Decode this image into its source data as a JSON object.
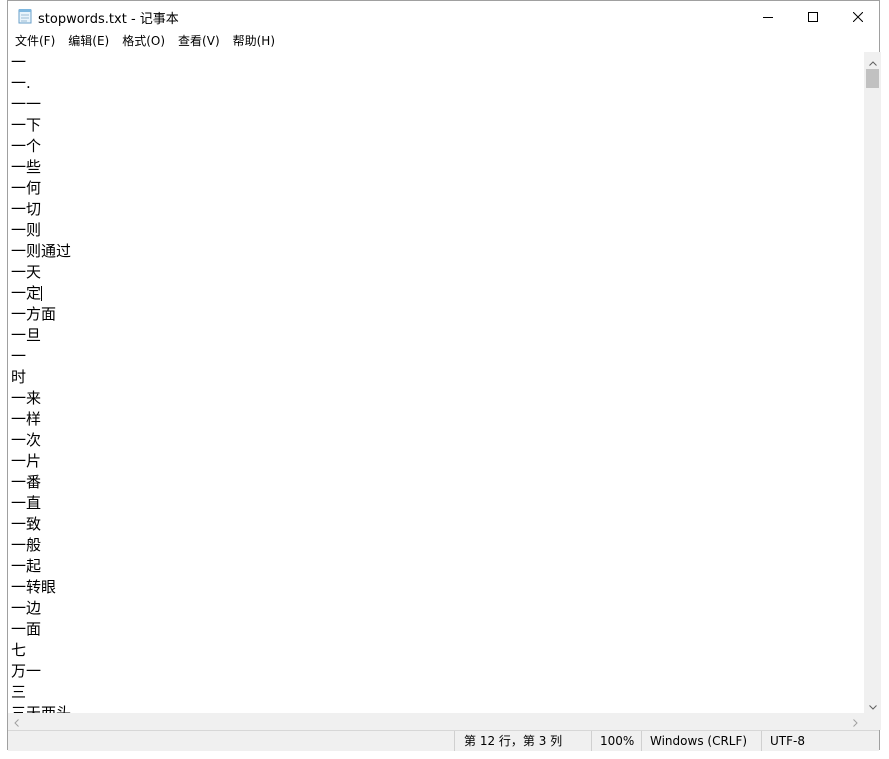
{
  "window": {
    "title": "stopwords.txt - 记事本",
    "icon": "notepad-icon"
  },
  "controls": {
    "minimize_icon": "minimize-icon",
    "maximize_icon": "maximize-icon",
    "close_icon": "close-icon"
  },
  "menu": {
    "items": [
      {
        "label": "文件(F)"
      },
      {
        "label": "编辑(E)"
      },
      {
        "label": "格式(O)"
      },
      {
        "label": "查看(V)"
      },
      {
        "label": "帮助(H)"
      }
    ]
  },
  "editor": {
    "lines": [
      "一",
      "一.",
      "一一",
      "一下",
      "一个",
      "一些",
      "一何",
      "一切",
      "一则",
      "一则通过",
      "一天",
      "一定",
      "一方面",
      "一旦",
      "一",
      "时",
      "一来",
      "一样",
      "一次",
      "一片",
      "一番",
      "一直",
      "一致",
      "一般",
      "一起",
      "一转眼",
      "一边",
      "一面",
      "七",
      "万一",
      "三",
      "三天两头"
    ],
    "caret_line": 12,
    "caret_column": 3
  },
  "status": {
    "position": "第 12 行，第 3 列",
    "zoom": "100%",
    "line_ending": "Windows (CRLF)",
    "encoding": "UTF-8"
  },
  "colors": {
    "chrome": "#f0f0f0",
    "text": "#000000",
    "scroll_thumb": "#c1c1c1"
  }
}
